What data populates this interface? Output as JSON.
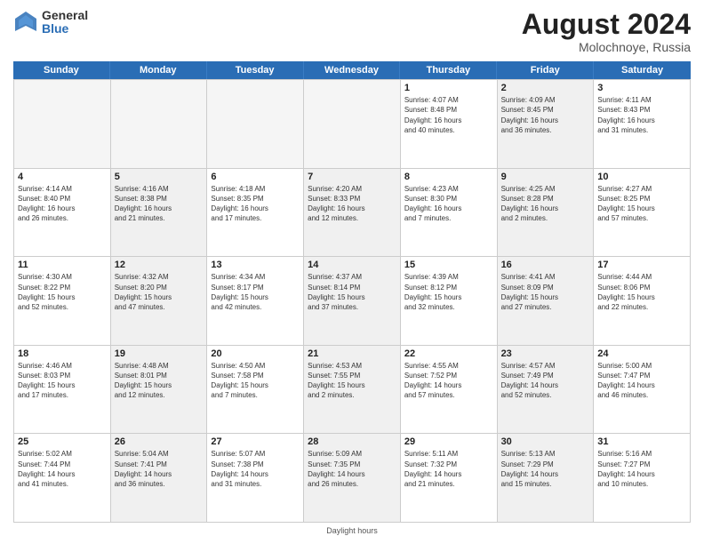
{
  "logo": {
    "line1": "General",
    "line2": "Blue"
  },
  "title": {
    "month": "August 2024",
    "location": "Molochnoye, Russia"
  },
  "calendar": {
    "headers": [
      "Sunday",
      "Monday",
      "Tuesday",
      "Wednesday",
      "Thursday",
      "Friday",
      "Saturday"
    ],
    "footer": "Daylight hours"
  },
  "days": [
    {
      "num": "",
      "info": "",
      "empty": true
    },
    {
      "num": "",
      "info": "",
      "empty": true
    },
    {
      "num": "",
      "info": "",
      "empty": true
    },
    {
      "num": "",
      "info": "",
      "empty": true
    },
    {
      "num": "1",
      "info": "Sunrise: 4:07 AM\nSunset: 8:48 PM\nDaylight: 16 hours\nand 40 minutes.",
      "empty": false,
      "shaded": false
    },
    {
      "num": "2",
      "info": "Sunrise: 4:09 AM\nSunset: 8:45 PM\nDaylight: 16 hours\nand 36 minutes.",
      "empty": false,
      "shaded": true
    },
    {
      "num": "3",
      "info": "Sunrise: 4:11 AM\nSunset: 8:43 PM\nDaylight: 16 hours\nand 31 minutes.",
      "empty": false,
      "shaded": false
    },
    {
      "num": "4",
      "info": "Sunrise: 4:14 AM\nSunset: 8:40 PM\nDaylight: 16 hours\nand 26 minutes.",
      "empty": false,
      "shaded": false
    },
    {
      "num": "5",
      "info": "Sunrise: 4:16 AM\nSunset: 8:38 PM\nDaylight: 16 hours\nand 21 minutes.",
      "empty": false,
      "shaded": true
    },
    {
      "num": "6",
      "info": "Sunrise: 4:18 AM\nSunset: 8:35 PM\nDaylight: 16 hours\nand 17 minutes.",
      "empty": false,
      "shaded": false
    },
    {
      "num": "7",
      "info": "Sunrise: 4:20 AM\nSunset: 8:33 PM\nDaylight: 16 hours\nand 12 minutes.",
      "empty": false,
      "shaded": true
    },
    {
      "num": "8",
      "info": "Sunrise: 4:23 AM\nSunset: 8:30 PM\nDaylight: 16 hours\nand 7 minutes.",
      "empty": false,
      "shaded": false
    },
    {
      "num": "9",
      "info": "Sunrise: 4:25 AM\nSunset: 8:28 PM\nDaylight: 16 hours\nand 2 minutes.",
      "empty": false,
      "shaded": true
    },
    {
      "num": "10",
      "info": "Sunrise: 4:27 AM\nSunset: 8:25 PM\nDaylight: 15 hours\nand 57 minutes.",
      "empty": false,
      "shaded": false
    },
    {
      "num": "11",
      "info": "Sunrise: 4:30 AM\nSunset: 8:22 PM\nDaylight: 15 hours\nand 52 minutes.",
      "empty": false,
      "shaded": false
    },
    {
      "num": "12",
      "info": "Sunrise: 4:32 AM\nSunset: 8:20 PM\nDaylight: 15 hours\nand 47 minutes.",
      "empty": false,
      "shaded": true
    },
    {
      "num": "13",
      "info": "Sunrise: 4:34 AM\nSunset: 8:17 PM\nDaylight: 15 hours\nand 42 minutes.",
      "empty": false,
      "shaded": false
    },
    {
      "num": "14",
      "info": "Sunrise: 4:37 AM\nSunset: 8:14 PM\nDaylight: 15 hours\nand 37 minutes.",
      "empty": false,
      "shaded": true
    },
    {
      "num": "15",
      "info": "Sunrise: 4:39 AM\nSunset: 8:12 PM\nDaylight: 15 hours\nand 32 minutes.",
      "empty": false,
      "shaded": false
    },
    {
      "num": "16",
      "info": "Sunrise: 4:41 AM\nSunset: 8:09 PM\nDaylight: 15 hours\nand 27 minutes.",
      "empty": false,
      "shaded": true
    },
    {
      "num": "17",
      "info": "Sunrise: 4:44 AM\nSunset: 8:06 PM\nDaylight: 15 hours\nand 22 minutes.",
      "empty": false,
      "shaded": false
    },
    {
      "num": "18",
      "info": "Sunrise: 4:46 AM\nSunset: 8:03 PM\nDaylight: 15 hours\nand 17 minutes.",
      "empty": false,
      "shaded": false
    },
    {
      "num": "19",
      "info": "Sunrise: 4:48 AM\nSunset: 8:01 PM\nDaylight: 15 hours\nand 12 minutes.",
      "empty": false,
      "shaded": true
    },
    {
      "num": "20",
      "info": "Sunrise: 4:50 AM\nSunset: 7:58 PM\nDaylight: 15 hours\nand 7 minutes.",
      "empty": false,
      "shaded": false
    },
    {
      "num": "21",
      "info": "Sunrise: 4:53 AM\nSunset: 7:55 PM\nDaylight: 15 hours\nand 2 minutes.",
      "empty": false,
      "shaded": true
    },
    {
      "num": "22",
      "info": "Sunrise: 4:55 AM\nSunset: 7:52 PM\nDaylight: 14 hours\nand 57 minutes.",
      "empty": false,
      "shaded": false
    },
    {
      "num": "23",
      "info": "Sunrise: 4:57 AM\nSunset: 7:49 PM\nDaylight: 14 hours\nand 52 minutes.",
      "empty": false,
      "shaded": true
    },
    {
      "num": "24",
      "info": "Sunrise: 5:00 AM\nSunset: 7:47 PM\nDaylight: 14 hours\nand 46 minutes.",
      "empty": false,
      "shaded": false
    },
    {
      "num": "25",
      "info": "Sunrise: 5:02 AM\nSunset: 7:44 PM\nDaylight: 14 hours\nand 41 minutes.",
      "empty": false,
      "shaded": false
    },
    {
      "num": "26",
      "info": "Sunrise: 5:04 AM\nSunset: 7:41 PM\nDaylight: 14 hours\nand 36 minutes.",
      "empty": false,
      "shaded": true
    },
    {
      "num": "27",
      "info": "Sunrise: 5:07 AM\nSunset: 7:38 PM\nDaylight: 14 hours\nand 31 minutes.",
      "empty": false,
      "shaded": false
    },
    {
      "num": "28",
      "info": "Sunrise: 5:09 AM\nSunset: 7:35 PM\nDaylight: 14 hours\nand 26 minutes.",
      "empty": false,
      "shaded": true
    },
    {
      "num": "29",
      "info": "Sunrise: 5:11 AM\nSunset: 7:32 PM\nDaylight: 14 hours\nand 21 minutes.",
      "empty": false,
      "shaded": false
    },
    {
      "num": "30",
      "info": "Sunrise: 5:13 AM\nSunset: 7:29 PM\nDaylight: 14 hours\nand 15 minutes.",
      "empty": false,
      "shaded": true
    },
    {
      "num": "31",
      "info": "Sunrise: 5:16 AM\nSunset: 7:27 PM\nDaylight: 14 hours\nand 10 minutes.",
      "empty": false,
      "shaded": false
    }
  ]
}
